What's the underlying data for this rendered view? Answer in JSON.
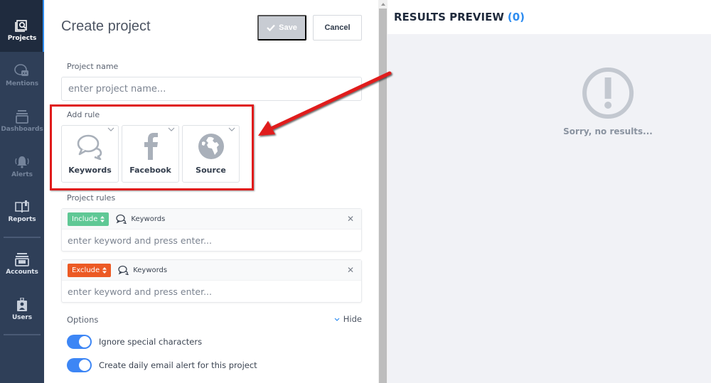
{
  "sidebar": {
    "items": [
      {
        "label": "Projects",
        "icon": "projects-icon",
        "active": true
      },
      {
        "label": "Mentions",
        "icon": "mentions-icon",
        "active": false
      },
      {
        "label": "Dashboards",
        "icon": "dashboards-icon",
        "active": false
      },
      {
        "label": "Alerts",
        "icon": "alerts-icon",
        "active": false
      },
      {
        "label": "Reports",
        "icon": "reports-icon",
        "active": false
      },
      {
        "label": "Accounts",
        "icon": "accounts-icon",
        "active": false
      },
      {
        "label": "Users",
        "icon": "users-icon",
        "active": false
      }
    ]
  },
  "form": {
    "title": "Create project",
    "save_label": "Save",
    "cancel_label": "Cancel",
    "project_name_label": "Project name",
    "project_name_placeholder": "enter project name...",
    "add_rule_label": "Add rule",
    "rule_tiles": [
      {
        "label": "Keywords",
        "icon": "speech-bubbles-icon"
      },
      {
        "label": "Facebook",
        "icon": "facebook-icon"
      },
      {
        "label": "Source",
        "icon": "globe-icon"
      }
    ],
    "project_rules_label": "Project rules",
    "rules": [
      {
        "mode": "Include",
        "type": "Keywords",
        "placeholder": "enter keyword and press enter...",
        "color": "#5fc895"
      },
      {
        "mode": "Exclude",
        "type": "Keywords",
        "placeholder": "enter keyword and press enter...",
        "color": "#ec5a24"
      }
    ],
    "options_label": "Options",
    "hide_label": "Hide",
    "toggles": [
      {
        "label": "Ignore special characters",
        "on": true
      },
      {
        "label": "Create daily email alert for this project",
        "on": true
      }
    ]
  },
  "results": {
    "title": "RESULTS PREVIEW",
    "count": "(0)",
    "empty_message": "Sorry, no results..."
  },
  "colors": {
    "accent": "#2d8cf0",
    "sidebar_bg": "#2f3f58",
    "include": "#5fc895",
    "exclude": "#ec5a24",
    "annotation": "#e01b1b"
  }
}
